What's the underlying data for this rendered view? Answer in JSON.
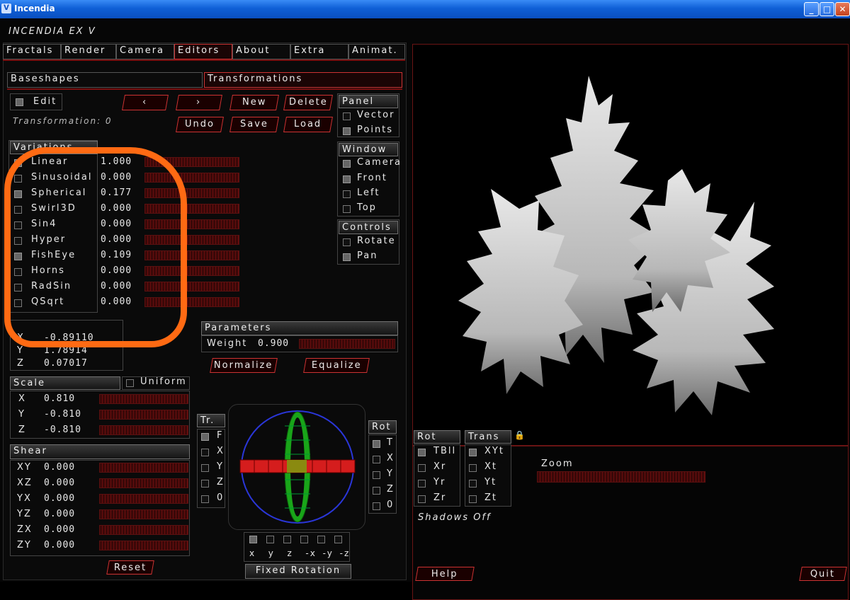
{
  "window": {
    "title": "Incendia",
    "app_name": "INCENDIA EX V",
    "icon": "incendia-logo-icon",
    "controls": [
      "_",
      "□",
      "✕"
    ]
  },
  "tabs": [
    {
      "label": "Fractals",
      "active": false
    },
    {
      "label": "Render",
      "active": false
    },
    {
      "label": "Camera",
      "active": false
    },
    {
      "label": "Editors",
      "active": true
    },
    {
      "label": "About",
      "active": false
    },
    {
      "label": "Extra",
      "active": false
    },
    {
      "label": "Animat.",
      "active": false
    }
  ],
  "subtabs": {
    "baseshapes": "Baseshapes",
    "transformations": "Transformations"
  },
  "editor": {
    "edit_label": "Edit",
    "transformation_label": "Transformation: 0",
    "prev_label": "‹",
    "next_label": "›",
    "new_label": "New",
    "delete_label": "Delete",
    "undo_label": "Undo",
    "save_label": "Save",
    "load_label": "Load"
  },
  "panel": {
    "header": "Panel",
    "items": [
      {
        "label": "Vector",
        "checked": false
      },
      {
        "label": "Points",
        "checked": true
      }
    ]
  },
  "window_group": {
    "header": "Window",
    "items": [
      {
        "label": "Camera",
        "checked": true
      },
      {
        "label": "Front",
        "checked": true
      },
      {
        "label": "Left",
        "checked": false
      },
      {
        "label": "Top",
        "checked": false
      }
    ]
  },
  "controls_group": {
    "header": "Controls",
    "items": [
      {
        "label": "Rotate",
        "checked": false
      },
      {
        "label": "Pan",
        "checked": true
      }
    ]
  },
  "variations": {
    "header": "Variations",
    "items": [
      {
        "label": "Linear",
        "value": "1.000",
        "checked": true
      },
      {
        "label": "Sinusoidal",
        "value": "0.000",
        "checked": false
      },
      {
        "label": "Spherical",
        "value": "0.177",
        "checked": true
      },
      {
        "label": "Swirl3D",
        "value": "0.000",
        "checked": false
      },
      {
        "label": "Sin4",
        "value": "0.000",
        "checked": false
      },
      {
        "label": "Hyper",
        "value": "0.000",
        "checked": false
      },
      {
        "label": "FishEye",
        "value": "0.109",
        "checked": true
      },
      {
        "label": "Horns",
        "value": "0.000",
        "checked": false
      },
      {
        "label": "RadSin",
        "value": "0.000",
        "checked": false
      },
      {
        "label": "QSqrt",
        "value": "0.000",
        "checked": false
      }
    ]
  },
  "position": {
    "x": "-0.89110",
    "y": "1.78914",
    "z": "0.07017"
  },
  "parameters": {
    "header": "Parameters",
    "weight_label": "Weight",
    "weight_value": "0.900",
    "normalize_label": "Normalize",
    "equalize_label": "Equalize"
  },
  "scale": {
    "header": "Scale",
    "uniform_label": "Uniform",
    "items": [
      {
        "axis": "X",
        "value": "0.810"
      },
      {
        "axis": "Y",
        "value": "-0.810"
      },
      {
        "axis": "Z",
        "value": "-0.810"
      }
    ]
  },
  "shear": {
    "header": "Shear",
    "items": [
      {
        "axis": "XY",
        "value": "0.000"
      },
      {
        "axis": "XZ",
        "value": "0.000"
      },
      {
        "axis": "YX",
        "value": "0.000"
      },
      {
        "axis": "YZ",
        "value": "0.000"
      },
      {
        "axis": "ZX",
        "value": "0.000"
      },
      {
        "axis": "ZY",
        "value": "0.000"
      }
    ]
  },
  "reset_label": "Reset",
  "tr_group": {
    "header": "Tr.",
    "items": [
      "F",
      "X",
      "Y",
      "Z",
      "0"
    ]
  },
  "rot_group": {
    "header": "Rot",
    "items": [
      "T",
      "X",
      "Y",
      "Z",
      "0"
    ]
  },
  "axis_buttons": {
    "labels": "x  y  z  -x -y -z",
    "fixed_rotation": "Fixed Rotation"
  },
  "view_rot": {
    "header": "Rot",
    "items": [
      "TBll",
      "Xr",
      "Yr",
      "Zr"
    ]
  },
  "view_trans": {
    "header": "Trans",
    "items": [
      "XYt",
      "Xt",
      "Yt",
      "Zt"
    ],
    "lock_icon": "lock-icon"
  },
  "zoom_label": "Zoom",
  "shadows_label": "Shadows Off",
  "help_label": "Help",
  "quit_label": "Quit",
  "colors": {
    "accent": "#cc3333",
    "annotation": "#ff6a13",
    "fractal": "#d8d8d8",
    "gizmo_green": "#22cc22",
    "gizmo_red": "#dd2222",
    "gizmo_blue": "#2244dd"
  }
}
